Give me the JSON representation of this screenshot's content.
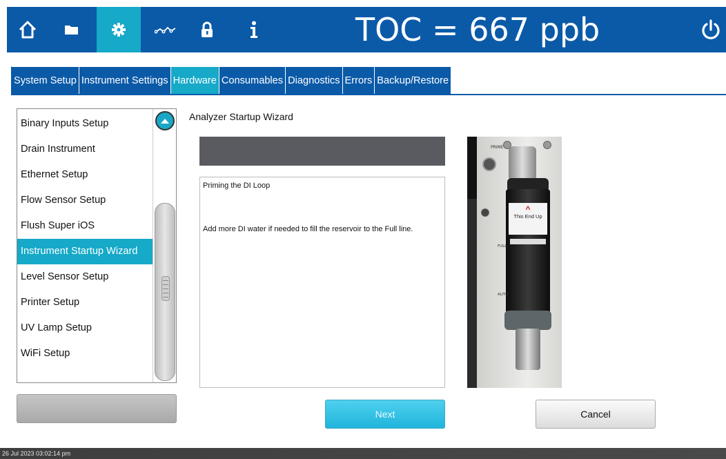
{
  "header": {
    "toc_reading": "TOC = 667 ppb",
    "nav_icons": [
      "home-icon",
      "folder-icon",
      "gear-icon",
      "trend-icon",
      "lock-icon",
      "info-icon"
    ],
    "active_icon": "gear-icon",
    "power_icon": "power-icon",
    "bar_color": "#0b5aa8",
    "active_color": "#16a9c8"
  },
  "tabs": [
    {
      "label": "System Setup"
    },
    {
      "label": "Instrument Settings"
    },
    {
      "label": "Hardware"
    },
    {
      "label": "Consumables"
    },
    {
      "label": "Diagnostics"
    },
    {
      "label": "Errors"
    },
    {
      "label": "Backup/Restore"
    }
  ],
  "active_tab": "Hardware",
  "sidebar": {
    "items": [
      {
        "label": "Binary Inputs Setup"
      },
      {
        "label": "Drain Instrument"
      },
      {
        "label": "Ethernet Setup"
      },
      {
        "label": "Flow Sensor Setup"
      },
      {
        "label": "Flush Super iOS"
      },
      {
        "label": "Instrument Startup Wizard"
      },
      {
        "label": "Level Sensor Setup"
      },
      {
        "label": "Printer Setup"
      },
      {
        "label": "UV Lamp Setup"
      },
      {
        "label": "WiFi Setup"
      }
    ],
    "selected": "Instrument Startup Wizard"
  },
  "wizard": {
    "title": "Analyzer Startup Wizard",
    "step_heading": "Priming the DI Loop",
    "step_text": "Add more DI water if needed to fill the reservoir to the Full line.",
    "image_labels": {
      "prime": "PRIME",
      "cartridge": "This End Up",
      "full": "FULL",
      "auto": "AUTO"
    },
    "next_label": "Next",
    "cancel_label": "Cancel"
  },
  "footer": {
    "timestamp": "26 Jul 2023 03:02:14 pm"
  }
}
